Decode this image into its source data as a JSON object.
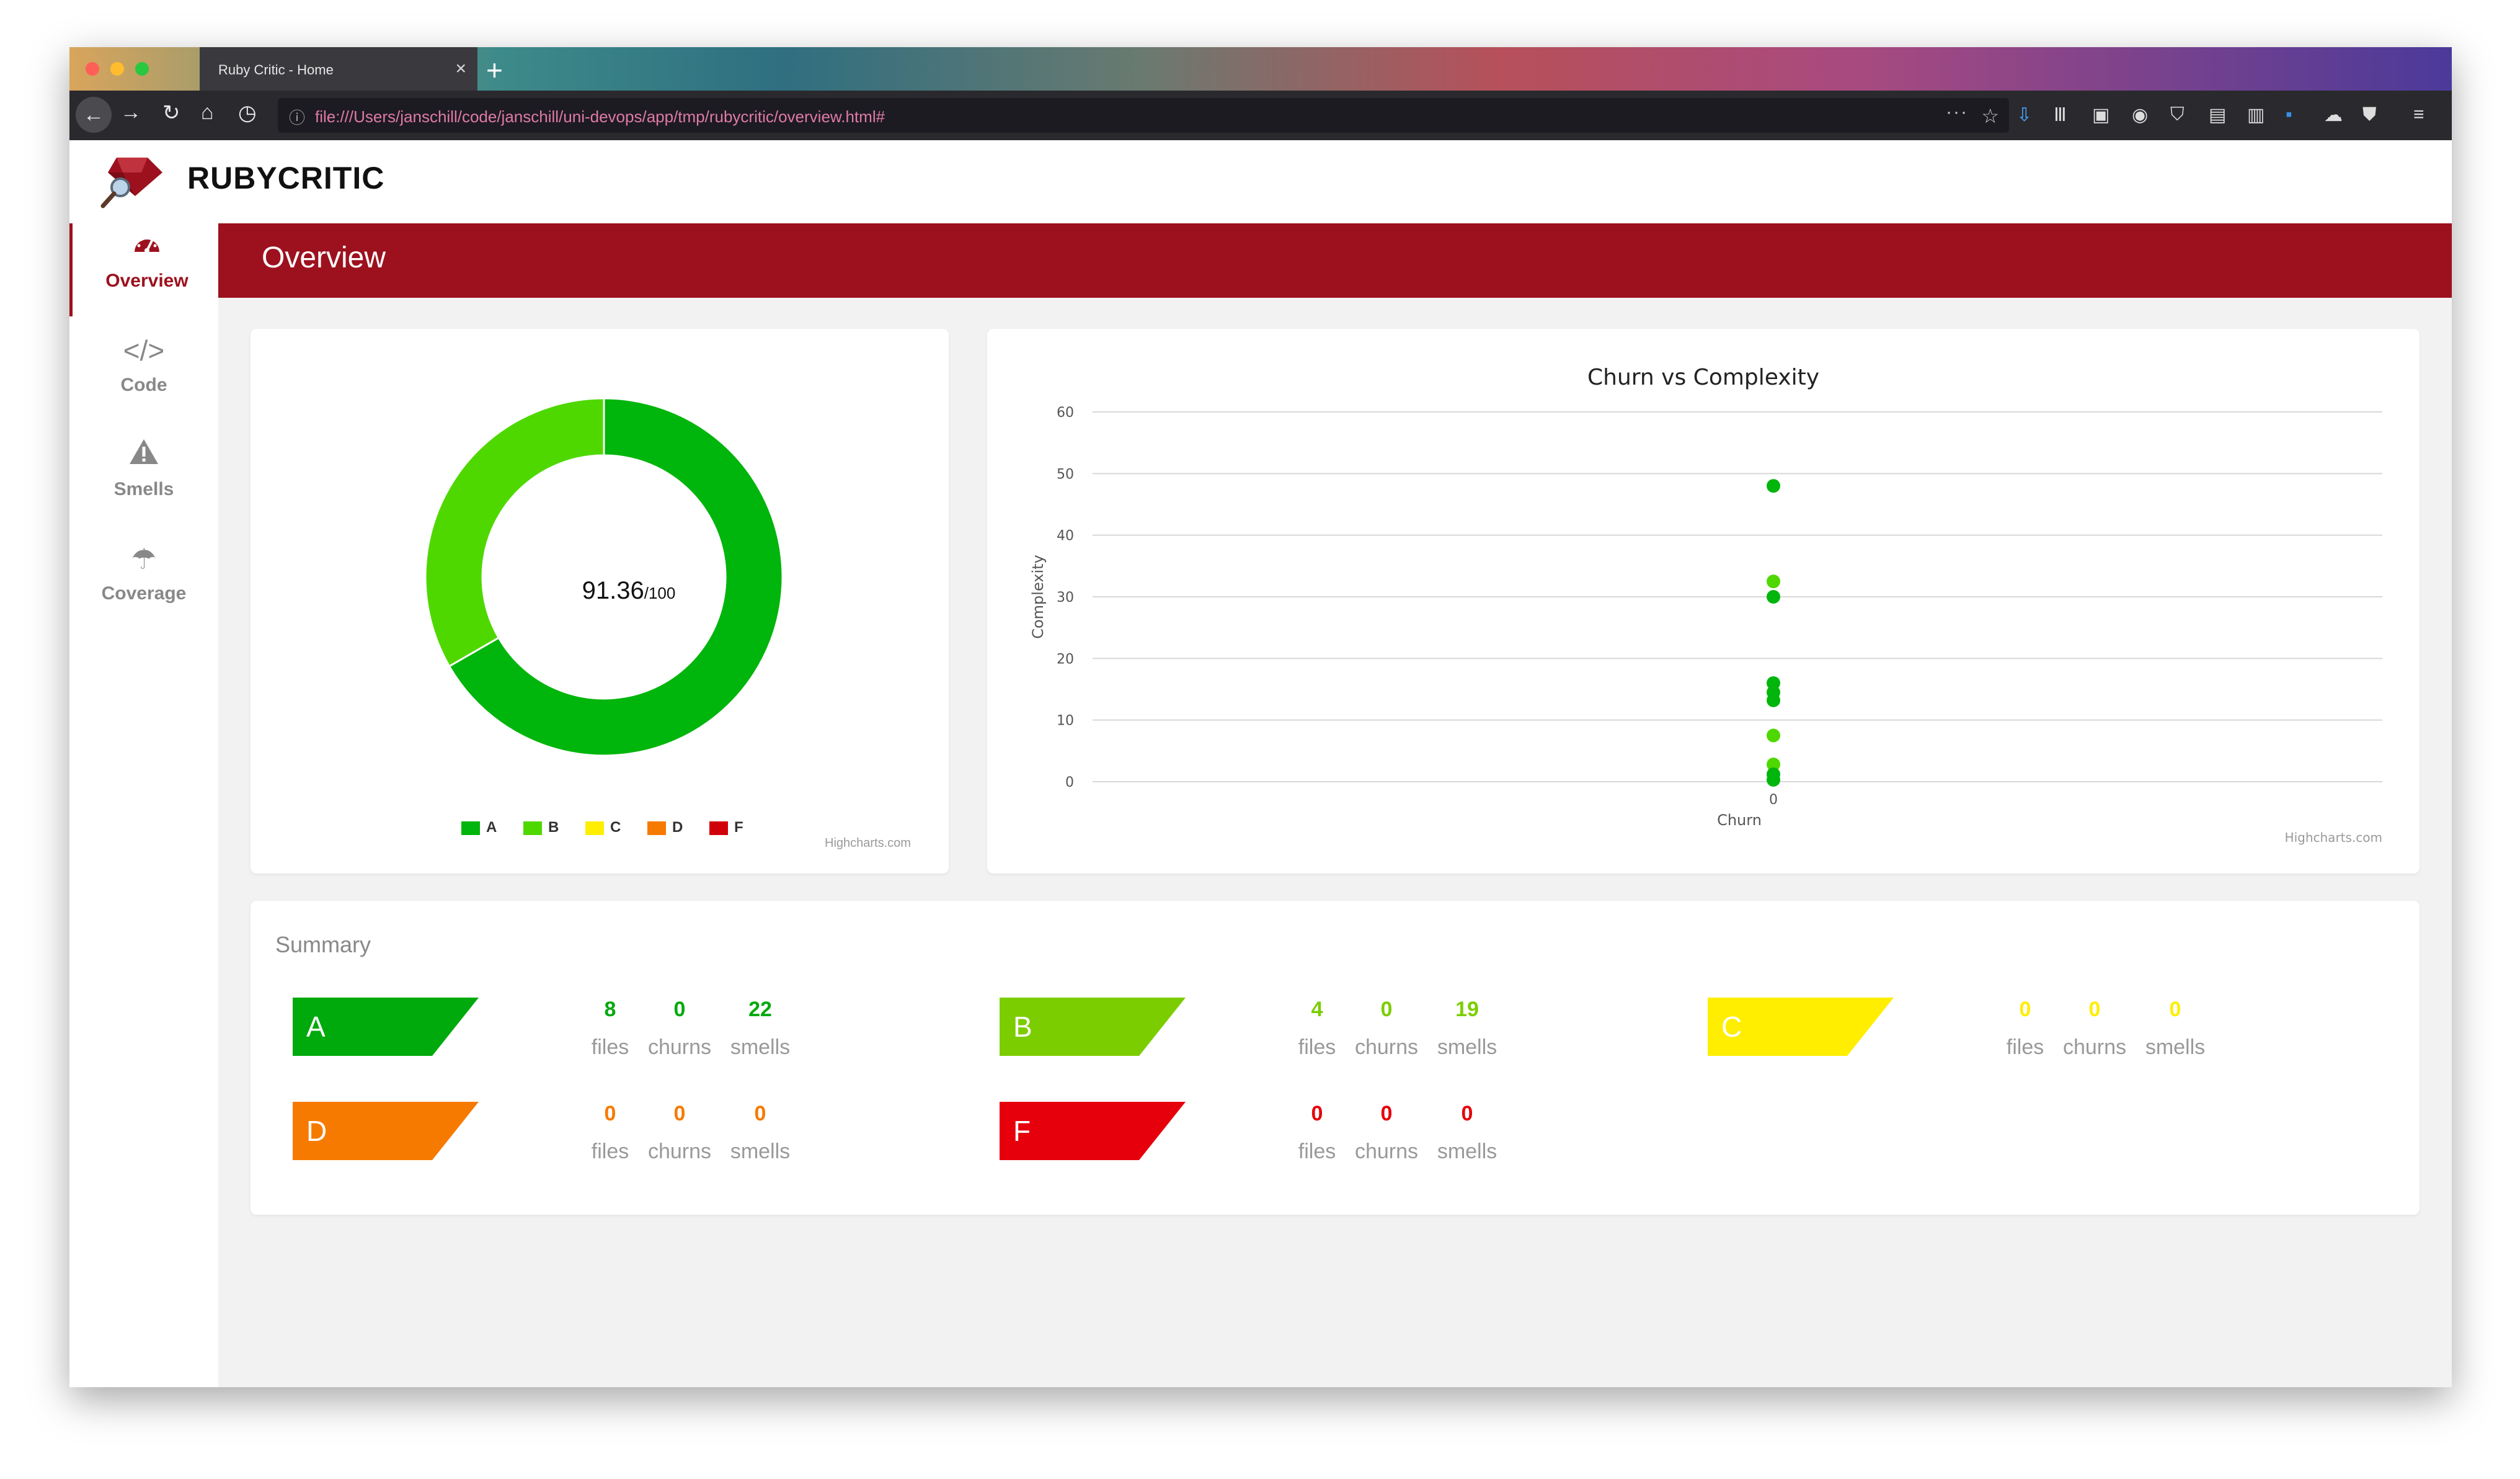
{
  "browser": {
    "tab_title": "Ruby Critic - Home",
    "url": "file:///Users/janschill/code/janschill/uni-devops/app/tmp/rubycritic/overview.html#"
  },
  "app": {
    "brand": "RUBYCRITIC"
  },
  "sidebar": {
    "items": [
      {
        "label": "Overview",
        "icon": "gauge-icon",
        "active": true
      },
      {
        "label": "Code",
        "icon": "code-icon",
        "active": false
      },
      {
        "label": "Smells",
        "icon": "warning-icon",
        "active": false
      },
      {
        "label": "Coverage",
        "icon": "umbrella-icon",
        "active": false
      }
    ]
  },
  "page": {
    "title": "Overview"
  },
  "colors": {
    "A": "#00a90c",
    "B": "#7ccd00",
    "C": "#ffee00",
    "D": "#f77a00",
    "F": "#e5000c",
    "A_chart": "#00b50b",
    "B_chart": "#4fd800",
    "C_chart": "#ffee00",
    "D_chart": "#f77a00",
    "F_chart": "#d0000a",
    "brand": "#9d111e"
  },
  "donut": {
    "score": "91.36",
    "max": "/100",
    "credit": "Highcharts.com",
    "legend": [
      "A",
      "B",
      "C",
      "D",
      "F"
    ],
    "slices": [
      {
        "grade": "A",
        "fraction": 0.6667
      },
      {
        "grade": "B",
        "fraction": 0.3333
      },
      {
        "grade": "C",
        "fraction": 0
      },
      {
        "grade": "D",
        "fraction": 0
      },
      {
        "grade": "F",
        "fraction": 0
      }
    ]
  },
  "chart_data": {
    "type": "scatter",
    "title": "Churn vs Complexity",
    "xlabel": "Churn",
    "ylabel": "Complexity",
    "credit": "Highcharts.com",
    "yticks": [
      "0",
      "10",
      "20",
      "30",
      "40",
      "50",
      "60"
    ],
    "xticks": [
      "0"
    ],
    "ylim": [
      0,
      60
    ],
    "grid": true,
    "points": [
      {
        "x": 0,
        "y": 48,
        "grade": "A"
      },
      {
        "x": 0,
        "y": 32.5,
        "grade": "B"
      },
      {
        "x": 0,
        "y": 30,
        "grade": "A"
      },
      {
        "x": 0,
        "y": 16,
        "grade": "A"
      },
      {
        "x": 0,
        "y": 14.5,
        "grade": "A"
      },
      {
        "x": 0,
        "y": 13.2,
        "grade": "A"
      },
      {
        "x": 0,
        "y": 7.5,
        "grade": "B"
      },
      {
        "x": 0,
        "y": 2.8,
        "grade": "B"
      },
      {
        "x": 0,
        "y": 1.2,
        "grade": "A"
      },
      {
        "x": 0,
        "y": 0.3,
        "grade": "A"
      }
    ]
  },
  "summary": {
    "title": "Summary",
    "grades": [
      {
        "grade": "A",
        "files": "8",
        "churns": "0",
        "smells": "22",
        "files_label": "files",
        "churns_label": "churns",
        "smells_label": "smells"
      },
      {
        "grade": "B",
        "files": "4",
        "churns": "0",
        "smells": "19",
        "files_label": "files",
        "churns_label": "churns",
        "smells_label": "smells"
      },
      {
        "grade": "C",
        "files": "0",
        "churns": "0",
        "smells": "0",
        "files_label": "files",
        "churns_label": "churns",
        "smells_label": "smells"
      },
      {
        "grade": "D",
        "files": "0",
        "churns": "0",
        "smells": "0",
        "files_label": "files",
        "churns_label": "churns",
        "smells_label": "smells"
      },
      {
        "grade": "F",
        "files": "0",
        "churns": "0",
        "smells": "0",
        "files_label": "files",
        "churns_label": "churns",
        "smells_label": "smells"
      }
    ]
  }
}
